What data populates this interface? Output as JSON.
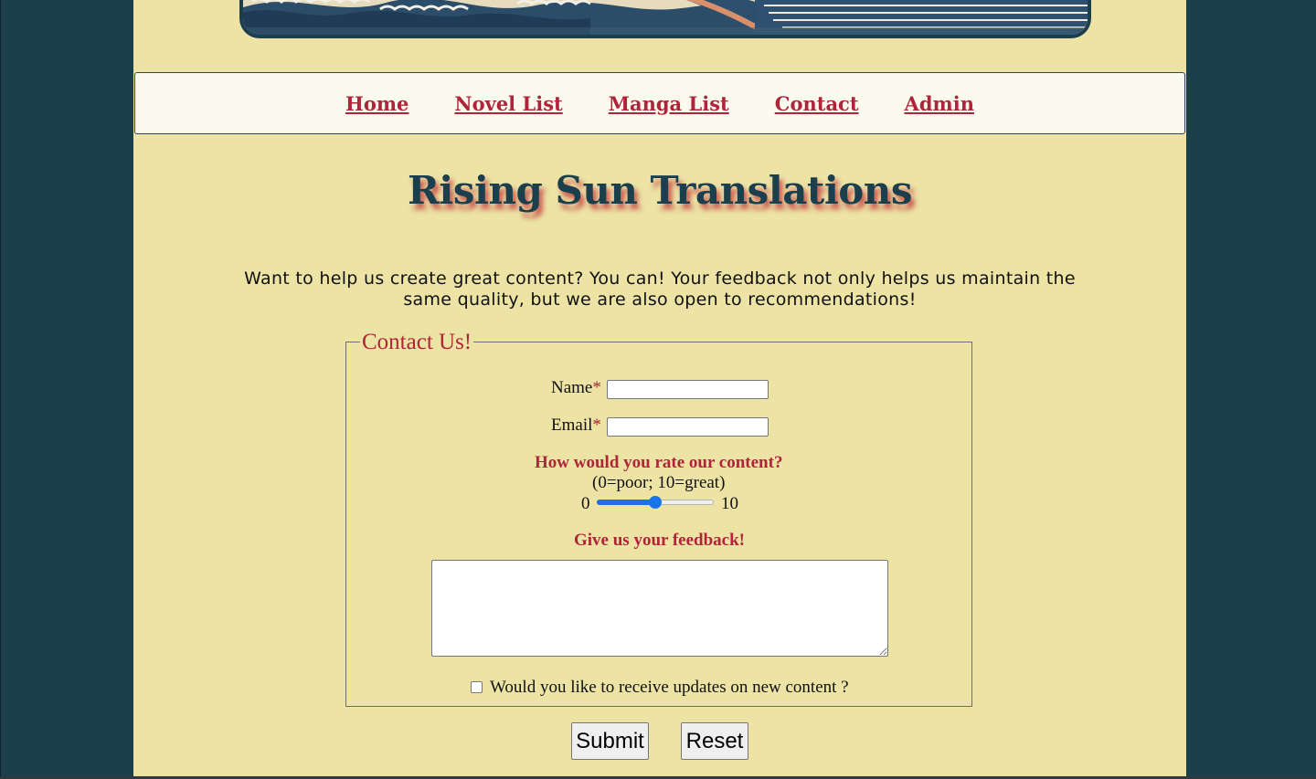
{
  "banner": {
    "image": "great-wave-banner"
  },
  "nav": {
    "items": [
      {
        "label": "Home"
      },
      {
        "label": "Novel List"
      },
      {
        "label": "Manga List"
      },
      {
        "label": "Contact"
      },
      {
        "label": "Admin"
      }
    ]
  },
  "header": {
    "site_title": "Rising Sun Translations"
  },
  "intro": {
    "text": "Want to help us create great content? You can! Your feedback not only helps us maintain the same quality, but we are also open to recommendations!"
  },
  "form": {
    "legend": "Contact Us!",
    "name_label": "Name",
    "email_label": "Email",
    "required_mark": "*",
    "name_value": "",
    "email_value": "",
    "rating_question": "How would you rate our content?",
    "rating_hint": "(0=poor; 10=great)",
    "rating_min_label": "0",
    "rating_max_label": "10",
    "rating_min": 0,
    "rating_max": 10,
    "rating_value": 5,
    "feedback_label": "Give us your feedback!",
    "feedback_value": "",
    "updates_label": "Would you like to receive updates on new content ?",
    "updates_checked": false,
    "submit_label": "Submit",
    "reset_label": "Reset"
  },
  "colors": {
    "background": "#1c3f4e",
    "content": "#ece3a5",
    "accent": "#b0243a",
    "nav_bg": "#fbfaee",
    "slider": "#1a73e8"
  }
}
